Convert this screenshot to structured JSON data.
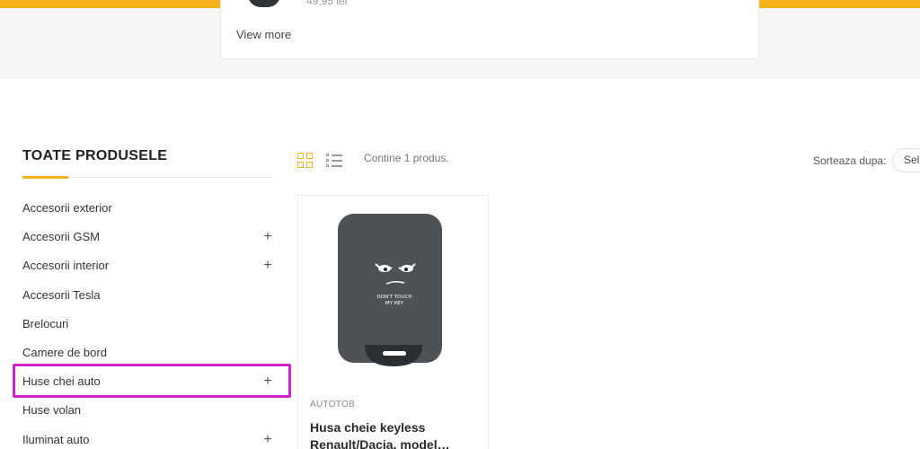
{
  "search_dropdown": {
    "price": "49,95 lei",
    "view_more_label": "View more"
  },
  "sidebar": {
    "title": "TOATE PRODUSELE",
    "categories": [
      {
        "label": "Accesorii exterior",
        "expandable": false
      },
      {
        "label": "Accesorii GSM",
        "expandable": true
      },
      {
        "label": "Accesorii interior",
        "expandable": true
      },
      {
        "label": "Accesorii Tesla",
        "expandable": false
      },
      {
        "label": "Brelocuri",
        "expandable": false
      },
      {
        "label": "Camere de bord",
        "expandable": false
      },
      {
        "label": "Huse chei auto",
        "expandable": true
      },
      {
        "label": "Huse volan",
        "expandable": false
      },
      {
        "label": "Iluminat auto",
        "expandable": true
      }
    ],
    "expand_symbol": "+"
  },
  "toolbar": {
    "product_count": "Contine 1 produs.",
    "sort_label": "Sorteaza dupa:",
    "sort_value": "Sele"
  },
  "product": {
    "brand": "AUTOTOB",
    "name": "Husa cheie keyless Renault/Dacia, model…",
    "image_text_line1": "DON'T TOUCH",
    "image_text_line2": "MY KEY"
  },
  "colors": {
    "accent": "#f5b21b",
    "highlight": "#d21fcf"
  }
}
